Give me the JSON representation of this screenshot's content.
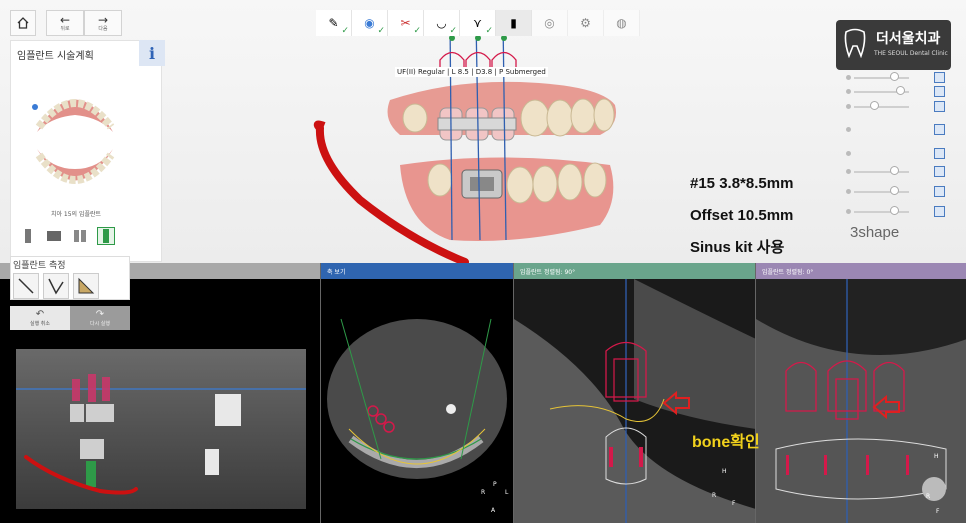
{
  "nav": {
    "back_label": "뒤로",
    "next_label": "다음"
  },
  "plan_panel": {
    "title": "임플란트 시술계획",
    "subtitle": "치아 15의 임플란트"
  },
  "measure_panel": {
    "title": "임플란트 측정"
  },
  "actions": {
    "undo_label": "실행 취소",
    "redo_label": "다시 실행"
  },
  "logo": {
    "name_ko": "더서울치과",
    "name_en": "THE SEOUL Dental Clinic"
  },
  "brand": "3shape",
  "implant_label": "UF(II) Regular | L 8.5 | D3.8 | P Submerged",
  "annotation": {
    "line1": "#15 3.8*8.5mm",
    "line2": "Offset 10.5mm",
    "line3": "Sinus kit 사용",
    "bone_check": "bone확인"
  },
  "views": {
    "axial_title": "축 보기",
    "cross_title": "임플란트 정렬됨: 90°",
    "tangent_title": "임플란트 정렬됨: 0°"
  },
  "orientation": {
    "H": "H",
    "R": "R",
    "L": "L",
    "A": "A",
    "F": "F",
    "P": "P"
  },
  "colors": {
    "pane_axial": "#2f65b0",
    "pane_cross": "#6aa58c",
    "pane_tangent": "#9b87b3",
    "implant_red": "#d4194a",
    "nerve_red": "#cc1111",
    "accent_green": "#2e9a48"
  }
}
